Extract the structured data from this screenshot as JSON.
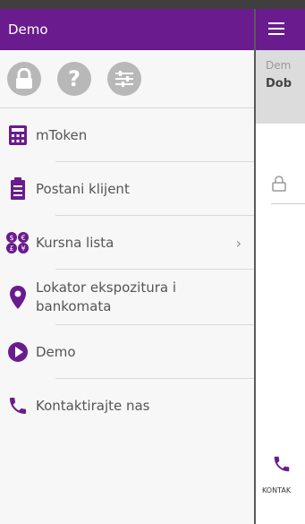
{
  "drawer": {
    "title": "Demo",
    "top_icons": [
      "lock-icon",
      "help-icon",
      "settings-sliders-icon"
    ],
    "items": [
      {
        "label": "mToken",
        "icon": "calculator-icon",
        "chevron": false
      },
      {
        "label": "Postani klijent",
        "icon": "clipboard-icon",
        "chevron": false
      },
      {
        "label": "Kursna lista",
        "icon": "currency-exchange-icon",
        "chevron": true
      },
      {
        "label": "Lokator ekspozitura i bankomata",
        "icon": "location-pin-icon",
        "chevron": false
      },
      {
        "label": "Demo",
        "icon": "play-icon",
        "chevron": false
      },
      {
        "label": "Kontaktirajte nas",
        "icon": "phone-icon",
        "chevron": false
      }
    ]
  },
  "main": {
    "sub_text_1": "Dem",
    "sub_text_2": "Dob",
    "bottom_label": "KONTAK"
  },
  "colors": {
    "purple": "#6a1b8d",
    "icon_gray": "#b8b8b8"
  }
}
